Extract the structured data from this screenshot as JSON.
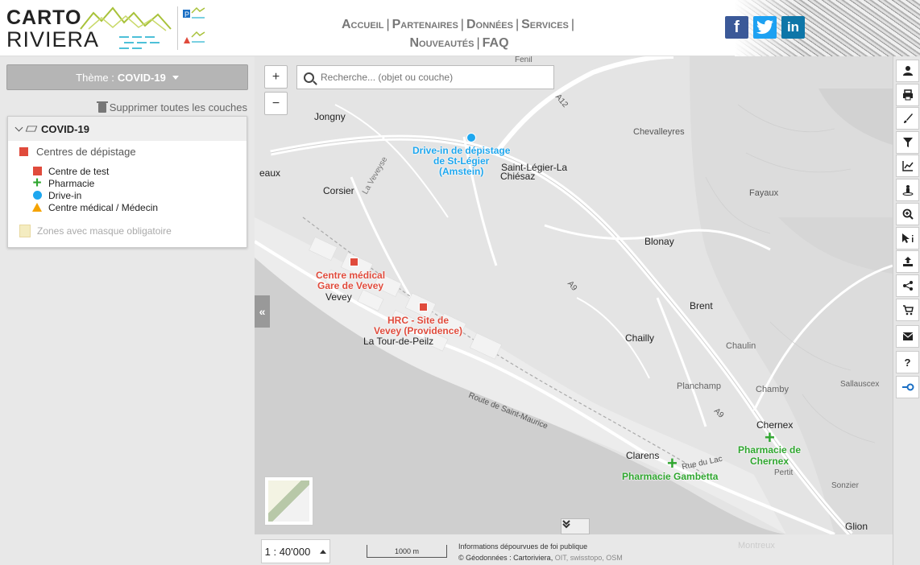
{
  "header": {
    "logo_line1": "CARTO",
    "logo_line2": "RIVIERA",
    "nav": [
      {
        "label": "Accueil"
      },
      {
        "label": "Partenaires"
      },
      {
        "label": "Données"
      },
      {
        "label": "Services"
      },
      {
        "label": "Nouveautés"
      },
      {
        "label": "FAQ"
      }
    ],
    "social": [
      {
        "name": "facebook",
        "glyph": "f",
        "color": "#3b5998"
      },
      {
        "name": "twitter",
        "glyph": "t",
        "color": "#1da1f2"
      },
      {
        "name": "linkedin",
        "glyph": "in",
        "color": "#0e76a8"
      }
    ]
  },
  "sidebar": {
    "theme_prefix": "Thème :",
    "theme_name": "COVID-19",
    "remove_all": "Supprimer toutes les couches",
    "layer_group": "COVID-19",
    "legend_title": "Centres de dépistage",
    "legend_items": [
      {
        "label": "Centre de test",
        "icon": "red-square",
        "color": "#e04b3c"
      },
      {
        "label": "Pharmacie",
        "icon": "green-cross",
        "color": "#2fa62f"
      },
      {
        "label": "Drive-in",
        "icon": "blue-circle",
        "color": "#1ea7ef"
      },
      {
        "label": "Centre médical / Médecin",
        "icon": "orange-triangle",
        "color": "#f5a300"
      }
    ],
    "zones_label": "Zones avec masque obligatoire"
  },
  "map": {
    "search_placeholder": "Recherche... (objet ou couche)",
    "zoom_in": "+",
    "zoom_out": "−",
    "collapse_glyph": "«",
    "expand_glyph": "⌄",
    "places": {
      "jongny": "Jongny",
      "corsier": "Corsier",
      "eaux": "eaux",
      "vevey": "Vevey",
      "stlegier": "Saint-Légier-La",
      "chiesaz": "Chiésaz",
      "chevalleyres": "Chevalleyres",
      "fayaux": "Fayaux",
      "blonay": "Blonay",
      "brent": "Brent",
      "chailly": "Chailly",
      "chaulin": "Chaulin",
      "tourdepeilz": "La Tour-de-Peilz",
      "planchamp": "Planchamp",
      "chamby": "Chamby",
      "sallaz": "Sallauscex",
      "chernex": "Chernex",
      "clarens": "Clarens",
      "pertit": "Pertit",
      "sonzier": "Sonzier",
      "glion": "Glion",
      "fenil": "Fenil",
      "route": "Route de Saint-Maurice",
      "ruedulac": "Rue du Lac",
      "a12": "A12",
      "a9a": "A9",
      "a9b": "A9",
      "laveyre": "La Veveyse"
    },
    "pois": {
      "drivein": "Drive-in de dépistage de St-Légier (Amstein)",
      "drivein_l1": "Drive-in de dépistage",
      "drivein_l2": "de St-Légier",
      "drivein_l3": "(Amstein)",
      "cmg_l1": "Centre médical",
      "cmg_l2": "Gare de Vevey",
      "hrc_l1": "HRC - Site de",
      "hrc_l2": "Vevey (Providence)",
      "pchernex_l1": "Pharmacie de",
      "pchernex_l2": "Chernex",
      "pgambetta": "Pharmacie Gambetta"
    }
  },
  "bottom": {
    "scale": "1 : 40'000",
    "scalebar": "1000 m",
    "disclaimer": "Informations dépourvues de foi publique",
    "copyright_prefix": "© Géodonnées : Cartoriviera,",
    "copyright_rest": "OIT, swisstopo, OSM",
    "montreux": "Montreux"
  },
  "toolbar": [
    {
      "name": "user-icon",
      "glyph": "👤"
    },
    {
      "name": "print-icon",
      "glyph": "⎙"
    },
    {
      "name": "brush-icon",
      "glyph": "✎"
    },
    {
      "name": "filter-icon",
      "glyph": "▼"
    },
    {
      "name": "chart-icon",
      "glyph": "↗"
    },
    {
      "name": "streetview-icon",
      "glyph": "♟"
    },
    {
      "name": "zoom-icon",
      "glyph": "⊕"
    },
    {
      "name": "info-icon",
      "glyph": "➤i"
    },
    {
      "name": "upload-icon",
      "glyph": "⇪"
    },
    {
      "name": "share-icon",
      "glyph": "≺"
    },
    {
      "name": "cart-icon",
      "glyph": "🛒"
    },
    {
      "name": "mail-icon",
      "glyph": "✉"
    },
    {
      "name": "help-icon",
      "glyph": "?"
    },
    {
      "name": "measure-icon",
      "glyph": "⟜"
    }
  ]
}
